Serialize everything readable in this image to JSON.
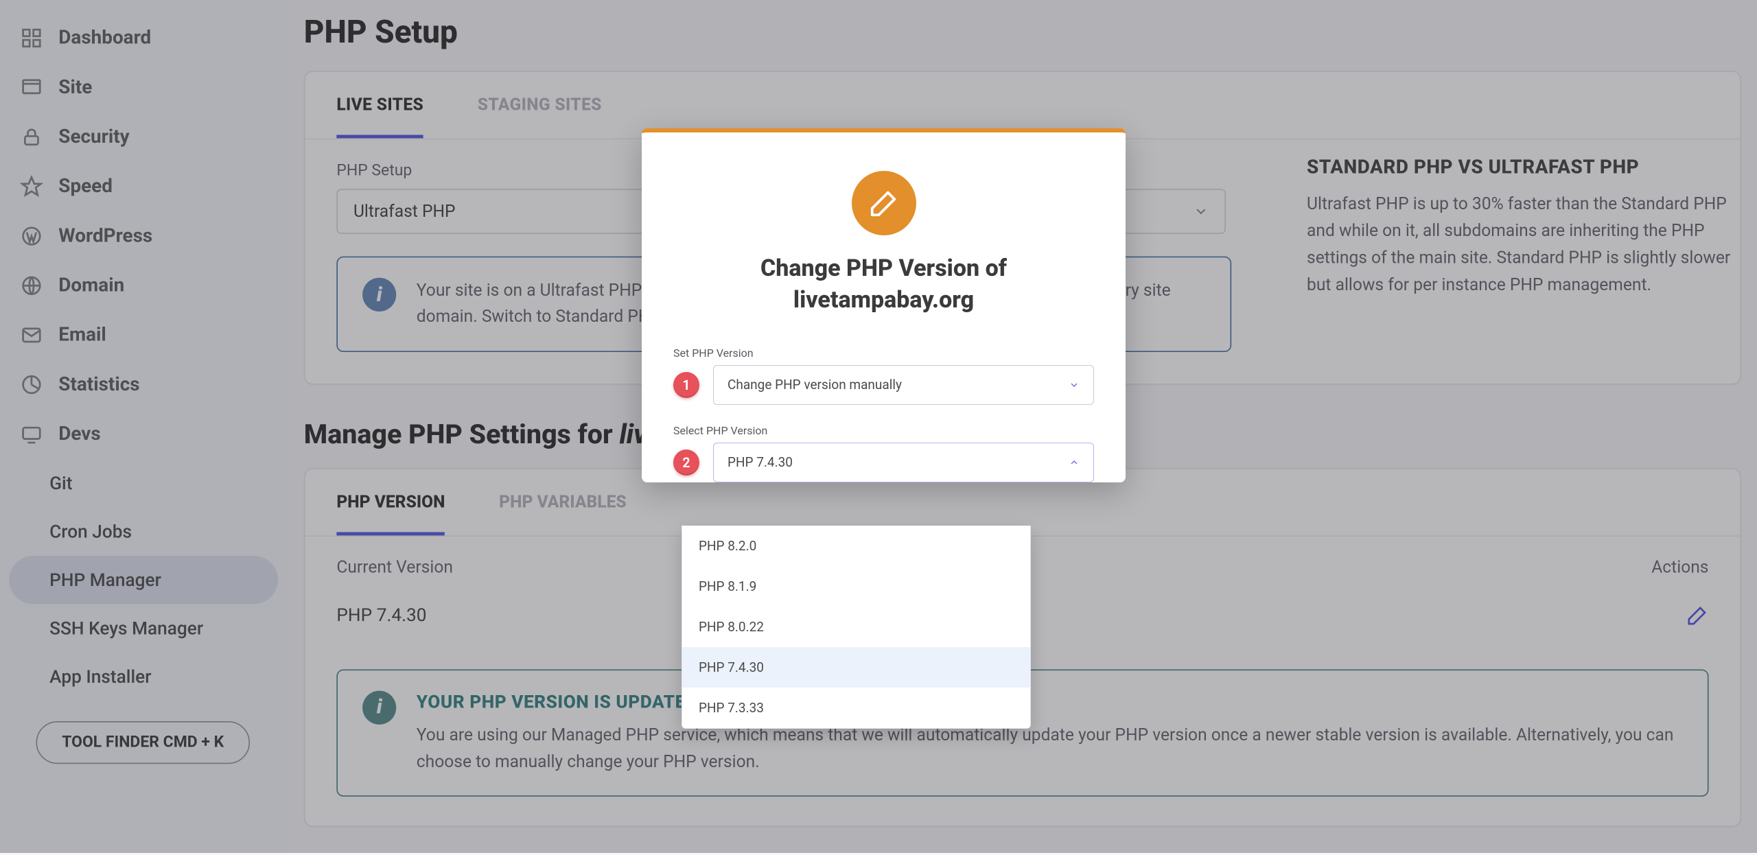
{
  "sidebar": {
    "items": [
      {
        "label": "Dashboard"
      },
      {
        "label": "Site"
      },
      {
        "label": "Security"
      },
      {
        "label": "Speed"
      },
      {
        "label": "WordPress"
      },
      {
        "label": "Domain"
      },
      {
        "label": "Email"
      },
      {
        "label": "Statistics"
      },
      {
        "label": "Devs"
      }
    ],
    "sub_items": [
      {
        "label": "Git"
      },
      {
        "label": "Cron Jobs"
      },
      {
        "label": "PHP Manager"
      },
      {
        "label": "SSH Keys Manager"
      },
      {
        "label": "App Installer"
      }
    ],
    "tool_finder": "TOOL FINDER CMD + K"
  },
  "page_title": "PHP Setup",
  "tabs": [
    {
      "label": "LIVE SITES",
      "active": true
    },
    {
      "label": "STAGING SITES",
      "active": false
    }
  ],
  "php_setup": {
    "label": "PHP Setup",
    "value": "Ultrafast PHP",
    "info": "Your site is on a Ultrafast PHP setup. All subdomains inherit the PHP version set for your primary site domain. Switch to Standard PHP to manage them separately."
  },
  "help": {
    "title": "STANDARD PHP VS ULTRAFAST PHP",
    "body": "Ultrafast PHP is up to 30% faster than the Standard PHP and while on it, all subdomains are inheriting the PHP settings of the main site. Standard PHP is slightly slower but allows for per instance PHP management."
  },
  "manage_heading_prefix": "Manage PHP Settings for ",
  "manage_heading_domain": "livetampabay.org",
  "tabs2": [
    {
      "label": "PHP VERSION",
      "active": true
    },
    {
      "label": "PHP VARIABLES",
      "active": false
    }
  ],
  "table": {
    "head_left": "Current Version",
    "head_right": "Actions",
    "row_value": "PHP 7.4.30"
  },
  "auto": {
    "title": "YOUR PHP VERSION IS UPDATED AUTOMATICALLY",
    "body": "You are using our Managed PHP service, which means that we will automatically update your PHP version once a newer stable version is available. Alternatively, you can choose to manually change your PHP version."
  },
  "modal": {
    "title_line1": "Change PHP Version of",
    "title_line2": "livetampabay.org",
    "step1_label": "Set PHP Version",
    "step1_value": "Change PHP version manually",
    "step2_label": "Select PHP Version",
    "step2_value": "PHP 7.4.30",
    "options": [
      "PHP 8.2.0",
      "PHP 8.1.9",
      "PHP 8.0.22",
      "PHP 7.4.30",
      "PHP 7.3.33"
    ],
    "selected_option": "PHP 7.4.30"
  }
}
